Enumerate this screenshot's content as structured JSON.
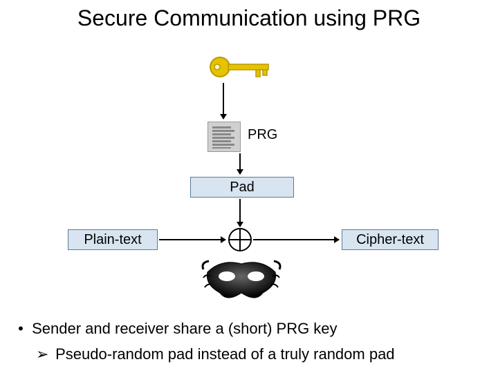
{
  "title": "Secure Communication using PRG",
  "labels": {
    "prg": "PRG",
    "pad": "Pad",
    "plaintext": "Plain-text",
    "ciphertext": "Cipher-text"
  },
  "bullets": [
    "Sender and receiver share a (short) PRG key",
    "Pseudo-random pad instead of a truly random pad"
  ]
}
